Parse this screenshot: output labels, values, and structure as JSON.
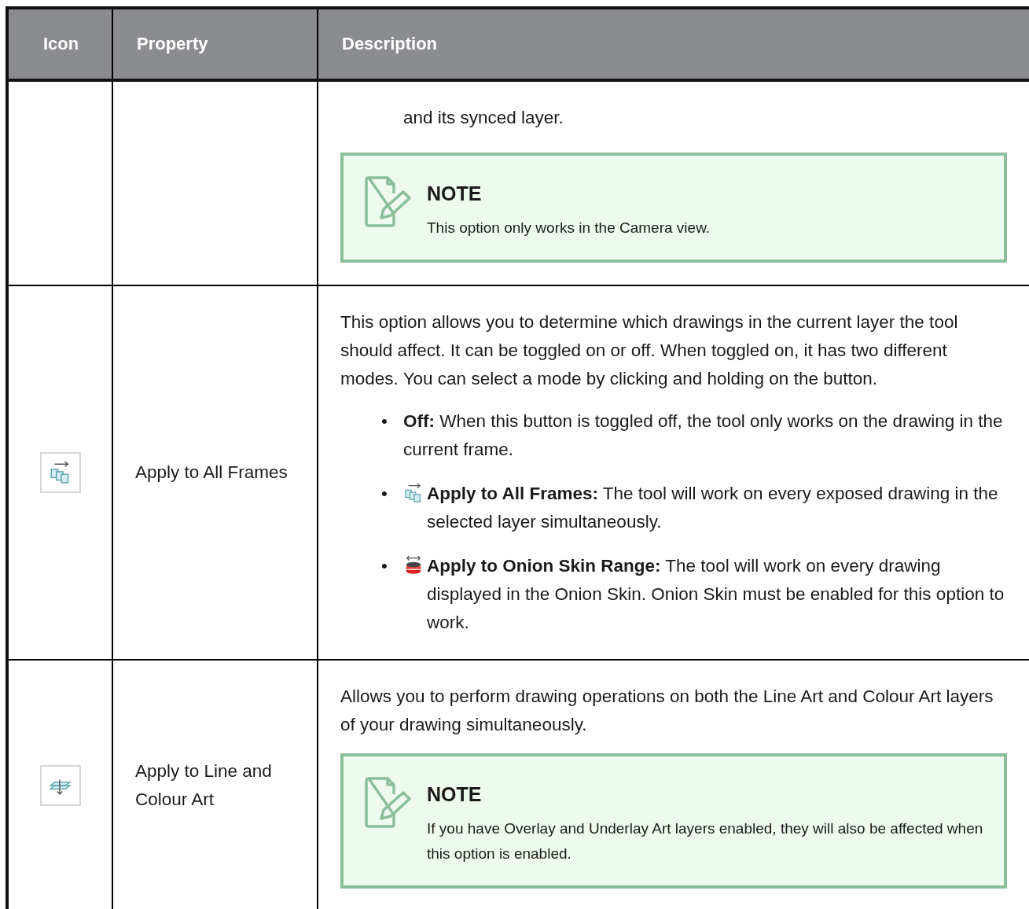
{
  "table": {
    "columns": [
      "Icon",
      "Property",
      "Description"
    ],
    "rows": [
      {
        "property": "",
        "description": [
          {
            "kind": "continuation",
            "text": "and its synced layer."
          },
          {
            "kind": "note",
            "title": "NOTE",
            "text": "This option only works in the Camera view."
          }
        ]
      },
      {
        "icon": {
          "kind": "frames"
        },
        "property": "Apply to All Frames",
        "description": [
          {
            "kind": "paragraph",
            "text": "This option allows you to determine which drawings in the current layer the tool should affect. It can be toggled on or off. When toggled on, it has two different modes. You can select a mode by clicking and holding on the button."
          },
          {
            "kind": "list",
            "items": [
              {
                "kind": "plain",
                "bullet": "•",
                "text": "**Off:** When this button is toggled off, the tool only works on the drawing in the current frame."
              },
              {
                "kind": "frames",
                "bullet": "•",
                "text": "**Apply to All Frames:** The tool will work on every exposed drawing in the selected layer simultaneously."
              },
              {
                "kind": "onion",
                "bullet": "•",
                "text": "**Apply to Onion Skin Range:** The tool will work on every drawing displayed in the Onion Skin. Onion Skin must be enabled for this option to work."
              }
            ]
          }
        ]
      },
      {
        "icon": {
          "kind": "layers"
        },
        "property": "Apply to Line and Colour Art",
        "description": [
          {
            "kind": "paragraph",
            "text": "Allows you to perform drawing operations on both the Line Art and Colour Art layers of your drawing simultaneously."
          },
          {
            "kind": "note",
            "title": "NOTE",
            "text": "If you have Overlay and Underlay Art layers enabled, they will also be affected when this option is enabled."
          }
        ]
      }
    ]
  }
}
